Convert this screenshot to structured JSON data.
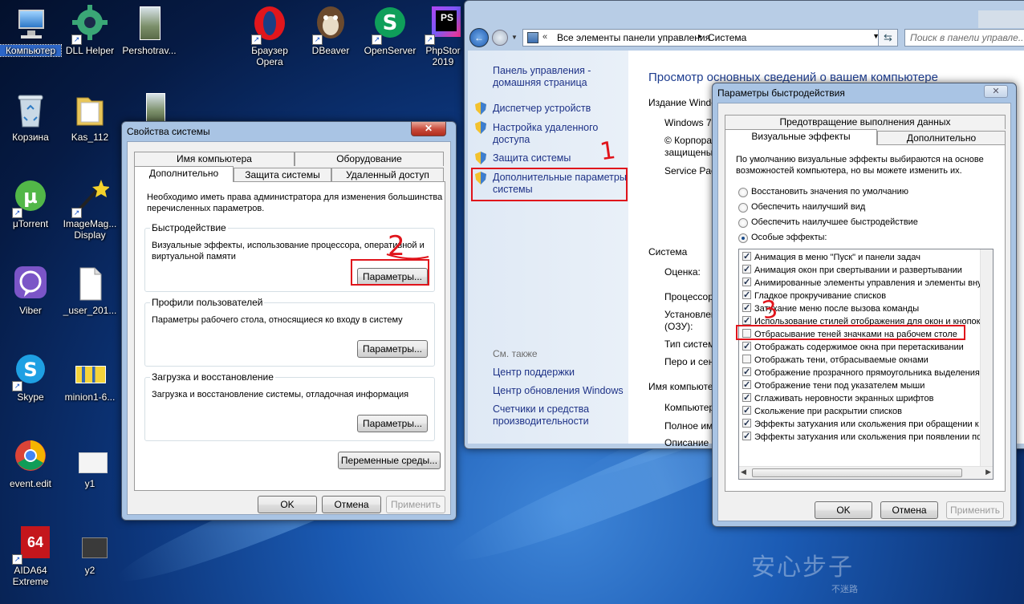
{
  "desktop": {
    "icons": [
      {
        "label": "Компьютер",
        "icon": "computer-icon",
        "selected": true
      },
      {
        "label": "DLL Helper",
        "icon": "gear-icon"
      },
      {
        "label": "Pershotrav...",
        "icon": "photo-icon"
      },
      {
        "label": "Браузер Opera",
        "icon": "opera-icon"
      },
      {
        "label": "DBeaver",
        "icon": "beaver-icon"
      },
      {
        "label": "OpenServer",
        "icon": "openserver-icon"
      },
      {
        "label": "PhpStor 2019",
        "icon": "phpstorm-icon"
      },
      {
        "label": "Корзина",
        "icon": "recycle-bin-icon"
      },
      {
        "label": "Kas_112",
        "icon": "folder-icon"
      },
      {
        "label": "μTorrent",
        "icon": "utorrent-icon"
      },
      {
        "label": "ImageMag... Display",
        "icon": "imagemagick-icon"
      },
      {
        "label": "Viber",
        "icon": "viber-icon"
      },
      {
        "label": "_user_201...",
        "icon": "document-icon"
      },
      {
        "label": "Skype",
        "icon": "skype-icon"
      },
      {
        "label": "minion1-6...",
        "icon": "image-icon"
      },
      {
        "label": "event.edit",
        "icon": "chrome-icon"
      },
      {
        "label": "y1",
        "icon": "image-icon"
      },
      {
        "label": "AIDA64 Extreme",
        "icon": "aida64-icon"
      },
      {
        "label": "y2",
        "icon": "image-icon"
      }
    ],
    "watermark": "安心步子",
    "watermark_small": "不迷路"
  },
  "system_properties": {
    "title": "Свойства системы",
    "close": "✕",
    "tabs_row1": [
      "Имя компьютера",
      "Оборудование"
    ],
    "tabs_row2": [
      "Дополнительно",
      "Защита системы",
      "Удаленный доступ"
    ],
    "admin_note": "Необходимо иметь права администратора для изменения большинства перечисленных параметров.",
    "perf_group": {
      "title": "Быстродействие",
      "desc": "Визуальные эффекты, использование процессора, оперативной и виртуальной памяти",
      "button": "Параметры..."
    },
    "profiles_group": {
      "title": "Профили пользователей",
      "desc": "Параметры рабочего стола, относящиеся ко входу в систему",
      "button": "Параметры..."
    },
    "startup_group": {
      "title": "Загрузка и восстановление",
      "desc": "Загрузка и восстановление системы, отладочная информация",
      "button": "Параметры..."
    },
    "env_button": "Переменные среды...",
    "ok": "OK",
    "cancel": "Отмена",
    "apply": "Применить"
  },
  "control_panel": {
    "breadcrumb": [
      "Все элементы панели управления",
      "Система"
    ],
    "search_placeholder": "Поиск в панели управле...",
    "home_link": "Панель управления - домашняя страница",
    "links": [
      "Диспетчер устройств",
      "Настройка удаленного доступа",
      "Защита системы",
      "Дополнительные параметры системы"
    ],
    "see_also": "См. также",
    "see_also_links": [
      "Центр поддержки",
      "Центр обновления Windows",
      "Счетчики и средства производительности"
    ],
    "heading": "Просмотр основных сведений о вашем компьютере",
    "edition_label": "Издание Windo",
    "edition_lines": [
      "Windows 7",
      "© Корпора",
      "защищены",
      "Service Pac"
    ],
    "system_label": "Система",
    "system_rows": [
      "Оценка:",
      "Процессор",
      "Установлен",
      "(ОЗУ):",
      "Тип систем",
      "Перо и сен"
    ],
    "computer_name_label": "Имя компьютера",
    "name_rows": [
      "Компьютер",
      "Полное им",
      "Описание"
    ]
  },
  "perf_options": {
    "title": "Параметры быстродействия",
    "tab_top": "Предотвращение выполнения данных",
    "tab_visual": "Визуальные эффекты",
    "tab_advanced": "Дополнительно",
    "intro": "По умолчанию визуальные эффекты выбираются на основе возможностей компьютера, но вы можете изменить их.",
    "radios": [
      {
        "label": "Восстановить значения по умолчанию",
        "checked": false
      },
      {
        "label": "Обеспечить наилучший вид",
        "checked": false
      },
      {
        "label": "Обеспечить наилучшее быстродействие",
        "checked": false
      },
      {
        "label": "Особые эффекты:",
        "checked": true
      }
    ],
    "effects": [
      {
        "label": "Анимация в меню \"Пуск\" и панели задач",
        "checked": true
      },
      {
        "label": "Анимация окон при свертывании и развертывании",
        "checked": true
      },
      {
        "label": "Анимированные элементы управления и элементы внутри",
        "checked": true
      },
      {
        "label": "Гладкое прокручивание списков",
        "checked": true
      },
      {
        "label": "Затухание меню после вызова команды",
        "checked": true
      },
      {
        "label": "Использование стилей отображения для окон и кнопок",
        "checked": true
      },
      {
        "label": "Отбрасывание теней значками на рабочем столе",
        "checked": false
      },
      {
        "label": "Отображать содержимое окна при перетаскивании",
        "checked": true
      },
      {
        "label": "Отображать тени, отбрасываемые окнами",
        "checked": false
      },
      {
        "label": "Отображение прозрачного прямоугольника выделения",
        "checked": true
      },
      {
        "label": "Отображение тени под указателем мыши",
        "checked": true
      },
      {
        "label": "Сглаживать неровности экранных шрифтов",
        "checked": true
      },
      {
        "label": "Скольжение при раскрытии списков",
        "checked": true
      },
      {
        "label": "Эффекты затухания или скольжения при обращении к ме",
        "checked": true
      },
      {
        "label": "Эффекты затухания или скольжения при появлении подс",
        "checked": true
      }
    ],
    "ok": "OK",
    "cancel": "Отмена",
    "apply": "Применить"
  },
  "annotations": [
    "1",
    "2",
    "3"
  ],
  "colors": {
    "annotation_red": "#e0141b",
    "link_blue": "#1e3287",
    "heading_blue": "#1e3d8f"
  }
}
